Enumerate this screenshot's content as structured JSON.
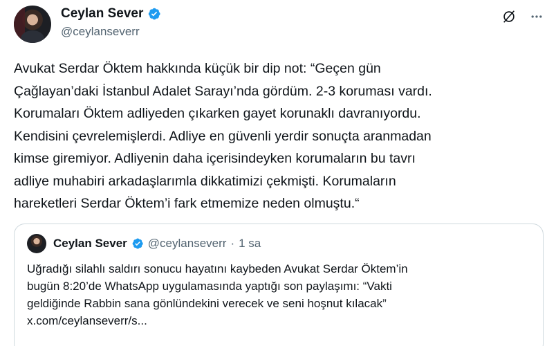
{
  "author": {
    "name": "Ceylan Sever",
    "handle": "@ceylanseverr",
    "verified_icon": "verified-badge-icon",
    "badge_color": "#1d9bf0"
  },
  "top_actions": {
    "grok_icon": "grok-icon",
    "more_icon": "more-options-icon"
  },
  "tweet": {
    "text": "Avukat Serdar Öktem hakkında küçük bir dip not: “Geçen gün\nÇağlayan’daki İstanbul Adalet Sarayı’nda gördüm. 2-3 koruması vardı.\nKorumaları Öktem adliyeden çıkarken gayet korunaklı davranıyordu.\nKendisini çevrelemişlerdi. Adliye en güvenli yerdir sonuçta aranmadan\nkimse giremiyor. Adliyenin daha içerisindeyken korumaların bu tavrı\nadliye muhabiri arkadaşlarımla dikkatimizi çekmişti. Korumaların\nhareketleri Serdar Öktem’i fark etmemize neden olmuştu.“"
  },
  "quote": {
    "name": "Ceylan Sever",
    "handle": "@ceylanseverr",
    "dot": "·",
    "time": "1 sa",
    "text": "Uğradığı silahlı saldırı sonucu hayatını kaybeden Avukat Serdar Öktem’in\nbugün 8:20’de WhatsApp uygulamasında yaptığı son paylaşımı: “Vakti\ngeldiğinde Rabbin sana gönlündekini verecek ve seni hoşnut kılacak”\nx.com/ceylanseverr/s..."
  },
  "colors": {
    "text": "#0f1419",
    "muted": "#536471",
    "border": "#cfd9de",
    "accent": "#1d9bf0"
  }
}
